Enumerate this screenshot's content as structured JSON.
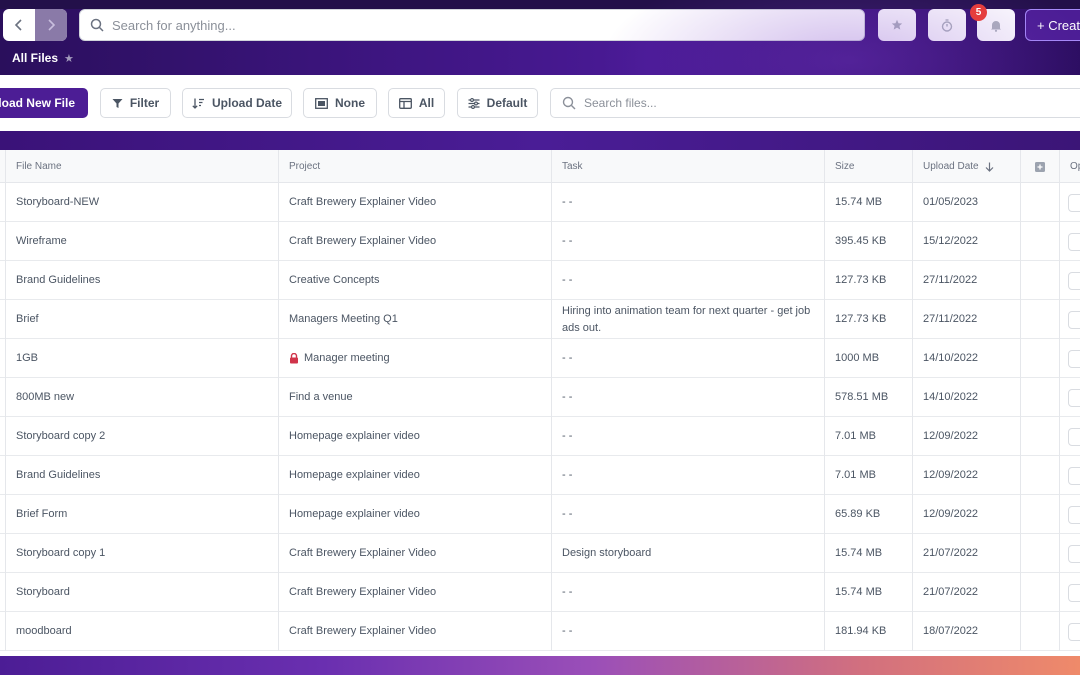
{
  "header": {
    "search_placeholder": "Search for anything...",
    "notification_count": "5",
    "create_label": "+ Create",
    "breadcrumb": "All Files"
  },
  "toolbar": {
    "upload_label": "Upload New File",
    "filter_label": "Filter",
    "sort_label": "Upload Date",
    "group_label": "None",
    "view_label": "All",
    "density_label": "Default",
    "file_search_placeholder": "Search files..."
  },
  "table": {
    "columns": {
      "file_name": "File Name",
      "project": "Project",
      "task": "Task",
      "size": "Size",
      "upload_date": "Upload Date",
      "options": "Op"
    },
    "rows": [
      {
        "file": "Storyboard-NEW",
        "project": "Craft Brewery Explainer Video",
        "task": "- -",
        "size": "15.74 MB",
        "date": "01/05/2023",
        "locked": false
      },
      {
        "file": "Wireframe",
        "project": "Craft Brewery Explainer Video",
        "task": "- -",
        "size": "395.45 KB",
        "date": "15/12/2022",
        "locked": false
      },
      {
        "file": "Brand Guidelines",
        "project": "Creative Concepts",
        "task": "- -",
        "size": "127.73 KB",
        "date": "27/11/2022",
        "locked": false
      },
      {
        "file": "Brief",
        "project": "Managers Meeting Q1",
        "task": "Hiring into animation team for next quarter - get job ads out.",
        "size": "127.73 KB",
        "date": "27/11/2022",
        "locked": false
      },
      {
        "file": "1GB",
        "project": "Manager meeting",
        "task": "- -",
        "size": "1000 MB",
        "date": "14/10/2022",
        "locked": true
      },
      {
        "file": "800MB new",
        "project": "Find a venue",
        "task": "- -",
        "size": "578.51 MB",
        "date": "14/10/2022",
        "locked": false
      },
      {
        "file": "Storyboard copy 2",
        "project": "Homepage explainer video",
        "task": "- -",
        "size": "7.01 MB",
        "date": "12/09/2022",
        "locked": false
      },
      {
        "file": "Brand Guidelines",
        "project": "Homepage explainer video",
        "task": "- -",
        "size": "7.01 MB",
        "date": "12/09/2022",
        "locked": false
      },
      {
        "file": "Brief Form",
        "project": "Homepage explainer video",
        "task": "- -",
        "size": "65.89 KB",
        "date": "12/09/2022",
        "locked": false
      },
      {
        "file": "Storyboard copy 1",
        "project": "Craft Brewery Explainer Video",
        "task": "Design storyboard",
        "size": "15.74 MB",
        "date": "21/07/2022",
        "locked": false
      },
      {
        "file": "Storyboard",
        "project": "Craft Brewery Explainer Video",
        "task": "- -",
        "size": "15.74 MB",
        "date": "21/07/2022",
        "locked": false
      },
      {
        "file": "moodboard",
        "project": "Craft Brewery Explainer Video",
        "task": "- -",
        "size": "181.94 KB",
        "date": "18/07/2022",
        "locked": false
      }
    ]
  },
  "colors": {
    "brand_purple": "#4c1d95",
    "badge_red": "#e53e3e",
    "lock_red": "#d0344a"
  }
}
